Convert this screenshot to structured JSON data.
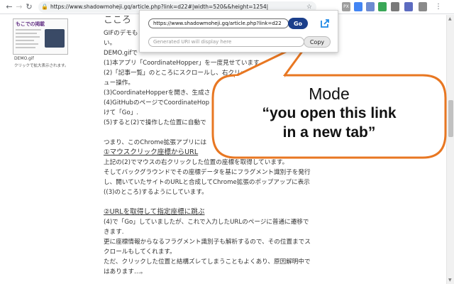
{
  "browser": {
    "url": "https://www.shadowmoheji.gq/article.php?link=d22#|width=520&&height=1254|",
    "extensions": [
      {
        "icon": "ext-pixel-icon",
        "label": "PX",
        "color": "#9e9e9e"
      },
      {
        "icon": "ext-blue-square-icon",
        "label": "",
        "color": "#4285f4"
      },
      {
        "icon": "ext-doc-icon",
        "label": "",
        "color": "#6d8bd1"
      },
      {
        "icon": "ext-green-icon",
        "label": "",
        "color": "#3aa757"
      },
      {
        "icon": "ext-camera-icon",
        "label": "",
        "color": "#7a7a7a"
      },
      {
        "icon": "ext-extension-icon",
        "label": "",
        "color": "#5c6bc0"
      },
      {
        "icon": "ext-grey-icon",
        "label": "",
        "color": "#8a8a8a"
      }
    ]
  },
  "popup": {
    "url_value": "https://www.shadowmoheji.gq/article.php?link=d22",
    "go_label": "Go",
    "generated_placeholder": "Generated URI will display here",
    "copy_label": "Copy",
    "accent": "#1b3f8b"
  },
  "sidebar": {
    "thumbnail_title": "もこでの掲載",
    "image_name": "DEMO.gif",
    "image_caption": "クリックで拡大表示されます。"
  },
  "article": {
    "partial_title": "こころ",
    "lines": [
      "GIFのデモも",
      "い。",
      "DEMO.gifで",
      "(1)本アプリ「CoordinateHopper」を一度見せています",
      "(2)「記事一覧」のところにスクロールし、右クリッ                    メー",
      "ュー操作。",
      "(3)CoordinateHopperを開き、生成さ",
      "(4)GitHubのページでCoordinateHop",
      "けて「Go」.",
      "(5)すると(2)で操作した位置に自動で",
      "",
      "つまり、このChrome拡張アプリには",
      "①マウスクリック座標からURL",
      "上記の(2)でマウスの右クリックした位置の座標を取得しています。",
      "そしてバックグラウンドでその座標データを基にフラグメント識別子を発行",
      "し、開いていたサイトのURLと合成してChrome拡張のポップアップに表示",
      "((3)のところ)するようにしています。",
      "",
      "②URLを取得して指定座標に跳ぶ",
      "(4)で「Go」していましたが、これで入力したURLのページに普通に遷移で",
      "きます.",
      "更に座標情報からなるフラグメント識別子も解析するので、その位置までス",
      "クロールもしてくれます。",
      "ただ、クリックした位置と結構ズレてしまうこともよくあり、原因解明中で",
      "はあります…。"
    ]
  },
  "callout": {
    "mode_label": "Mode",
    "description_line1": "“you open this link",
    "description_line2": "in a new tab”",
    "border_color": "#e87722"
  }
}
